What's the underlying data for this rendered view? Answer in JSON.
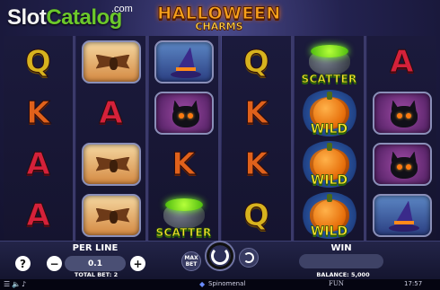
{
  "watermark": {
    "slot": "Slot",
    "catalog": "Catalog",
    "com": ".com"
  },
  "logo": {
    "line1": "HALLOWEEN",
    "line2": "CHARMS"
  },
  "reels": [
    [
      "Q",
      "K",
      "A",
      "A"
    ],
    [
      "bat",
      "A",
      "bat",
      "bat"
    ],
    [
      "hat",
      "cat",
      "K",
      "scatter"
    ],
    [
      "Q",
      "K",
      "K",
      "Q"
    ],
    [
      "scatter",
      "wild",
      "wild",
      "wild"
    ],
    [
      "A",
      "cat",
      "cat",
      "hat"
    ]
  ],
  "symbols": {
    "scatter_label": "SCATTER",
    "wild_label": "WILD"
  },
  "controls": {
    "help": "?",
    "per_line_label": "PER LINE",
    "per_line_value": "0.1",
    "minus": "−",
    "plus": "+",
    "total_bet": "TOTAL BET: 2",
    "max_bet_line1": "MAX",
    "max_bet_line2": "BET",
    "win_label": "WIN",
    "balance": "BALANCE: 5,000"
  },
  "footer": {
    "icons": [
      "menu-icon",
      "sound-icon",
      "music-icon"
    ],
    "provider": "Spinomenal",
    "mode": "FUN",
    "time": "17:57"
  },
  "colors": {
    "Q": "#d7b21e",
    "K": "#e0611b",
    "A": "#d5213a",
    "label_yellow": "#f6e12d",
    "catalog_green": "#6cc82b"
  }
}
